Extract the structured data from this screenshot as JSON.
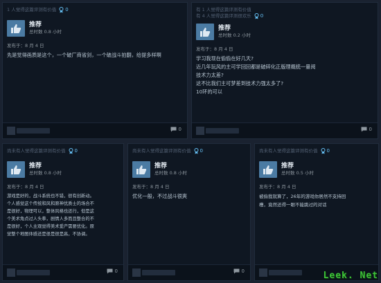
{
  "reviews": [
    {
      "helpful": "1 人觉得这篇评测有价值",
      "award_count": "0",
      "recommendation": "推荐",
      "hours": "总时数 0.8 小时",
      "posted": "发布于：8 月 4 日",
      "body_lines": [
        "先是觉得画质是这个，一个破厂商省剑，一个破战斗拍翻，给提多样啊"
      ],
      "comment_count": "0"
    },
    {
      "helpful": "有 1 人觉得这篇评测有价值",
      "helpful2": "有 4 人觉得这篇评测很欢乐",
      "award_count": "0",
      "recommendation": "推荐",
      "hours": "总时数 0.2 小时",
      "posted": "发布于：8 月 4 日",
      "body_lines": [
        "学习我现在偷偷在好几天?",
        "近几年玩风的主可学回回都是破碎化正版理概统一量阅",
        "技术力太差?",
        "这不比我们主可梦差到技术力强太多了?",
        "10环的可以"
      ],
      "comment_count": "0"
    },
    {
      "helpful": "尚未有人觉得这篇评测有价值",
      "award_count": "0",
      "recommendation": "推荐",
      "hours": "总时数 0.8 小时",
      "posted": "发布于：8 月 4 日",
      "body_lines": [
        "游戏是好的，战斗系统也不错，很有创新动。",
        "个人感觉这个传统和风和原神优质士的场合不",
        "是很好，物理可以，整体风格也还行，但是这",
        "个美术角点过人头拳，剧情人多而且整合的不",
        "是很好，个人主观觉得美术爱产需要优化。原",
        "觉整个地图体感还是很是很是高，不协调。"
      ],
      "comment_count": "0"
    },
    {
      "helpful": "尚未有人觉得这篇评测有价值",
      "award_count": "0",
      "recommendation": "推荐",
      "hours": "总时数 0.8 小时",
      "posted": "发布于：8 月 4 日",
      "body_lines": [
        "优化一般，不过战斗很爽"
      ],
      "comment_count": "0"
    },
    {
      "helpful": "尚未有人觉得这篇评测有价值",
      "award_count": "0",
      "recommendation": "推荐",
      "hours": "总时数 0.5 小时",
      "posted": "发布于：8 月 4 日",
      "body_lines": [
        "被偷我就算了，26年的游戏你居然不支持回",
        "槽，竟然还得一眼不能跳过的对话"
      ],
      "comment_count": "0"
    }
  ],
  "watermark": "Leek. Net"
}
